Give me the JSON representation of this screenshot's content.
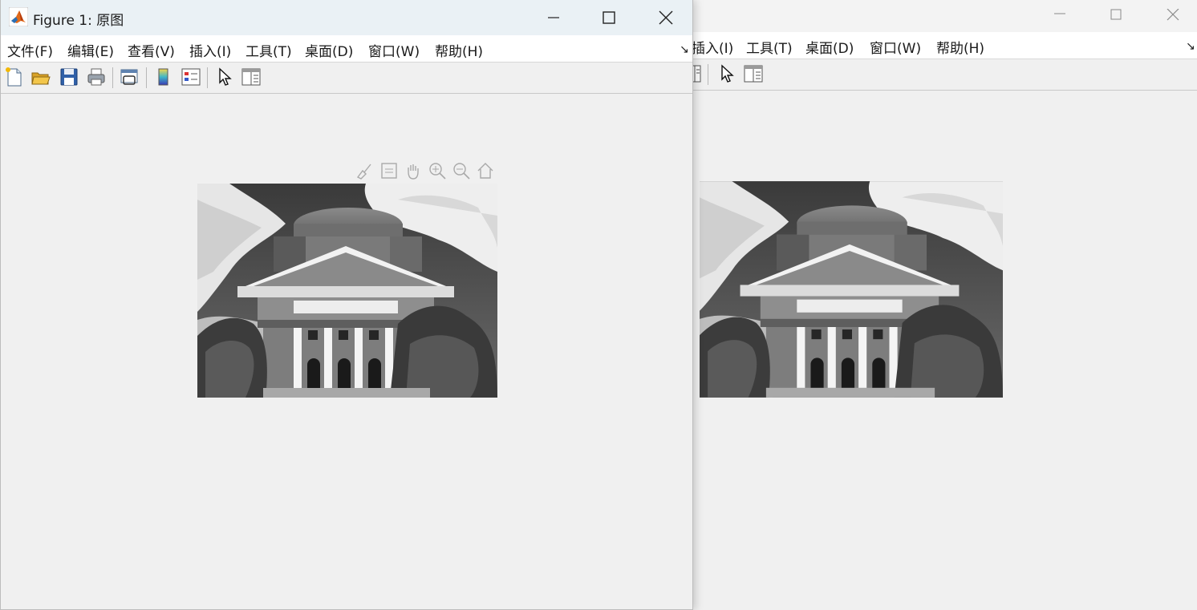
{
  "window_front": {
    "title": "Figure 1: 原图",
    "menu": [
      "文件(F)",
      "编辑(E)",
      "查看(V)",
      "插入(I)",
      "工具(T)",
      "桌面(D)",
      "窗口(W)",
      "帮助(H)"
    ],
    "toolbar_icons": [
      "new-figure-icon",
      "open-file-icon",
      "save-icon",
      "print-icon",
      "link-plot-icon",
      "colorbar-icon",
      "legend-icon",
      "edit-plot-icon",
      "property-inspector-icon"
    ],
    "axes_toolbar_icons": [
      "brush-icon",
      "data-tips-icon",
      "pan-icon",
      "zoom-in-icon",
      "zoom-out-icon",
      "home-icon"
    ],
    "image_name": "building-photo"
  },
  "window_back": {
    "menu": [
      "插入(I)",
      "工具(T)",
      "桌面(D)",
      "窗口(W)",
      "帮助(H)"
    ],
    "image_name": "building-photo"
  },
  "colors": {
    "title_bar": "#eaf1f5",
    "menu_bar": "#ffffff",
    "window_bg": "#f0f0f0"
  }
}
